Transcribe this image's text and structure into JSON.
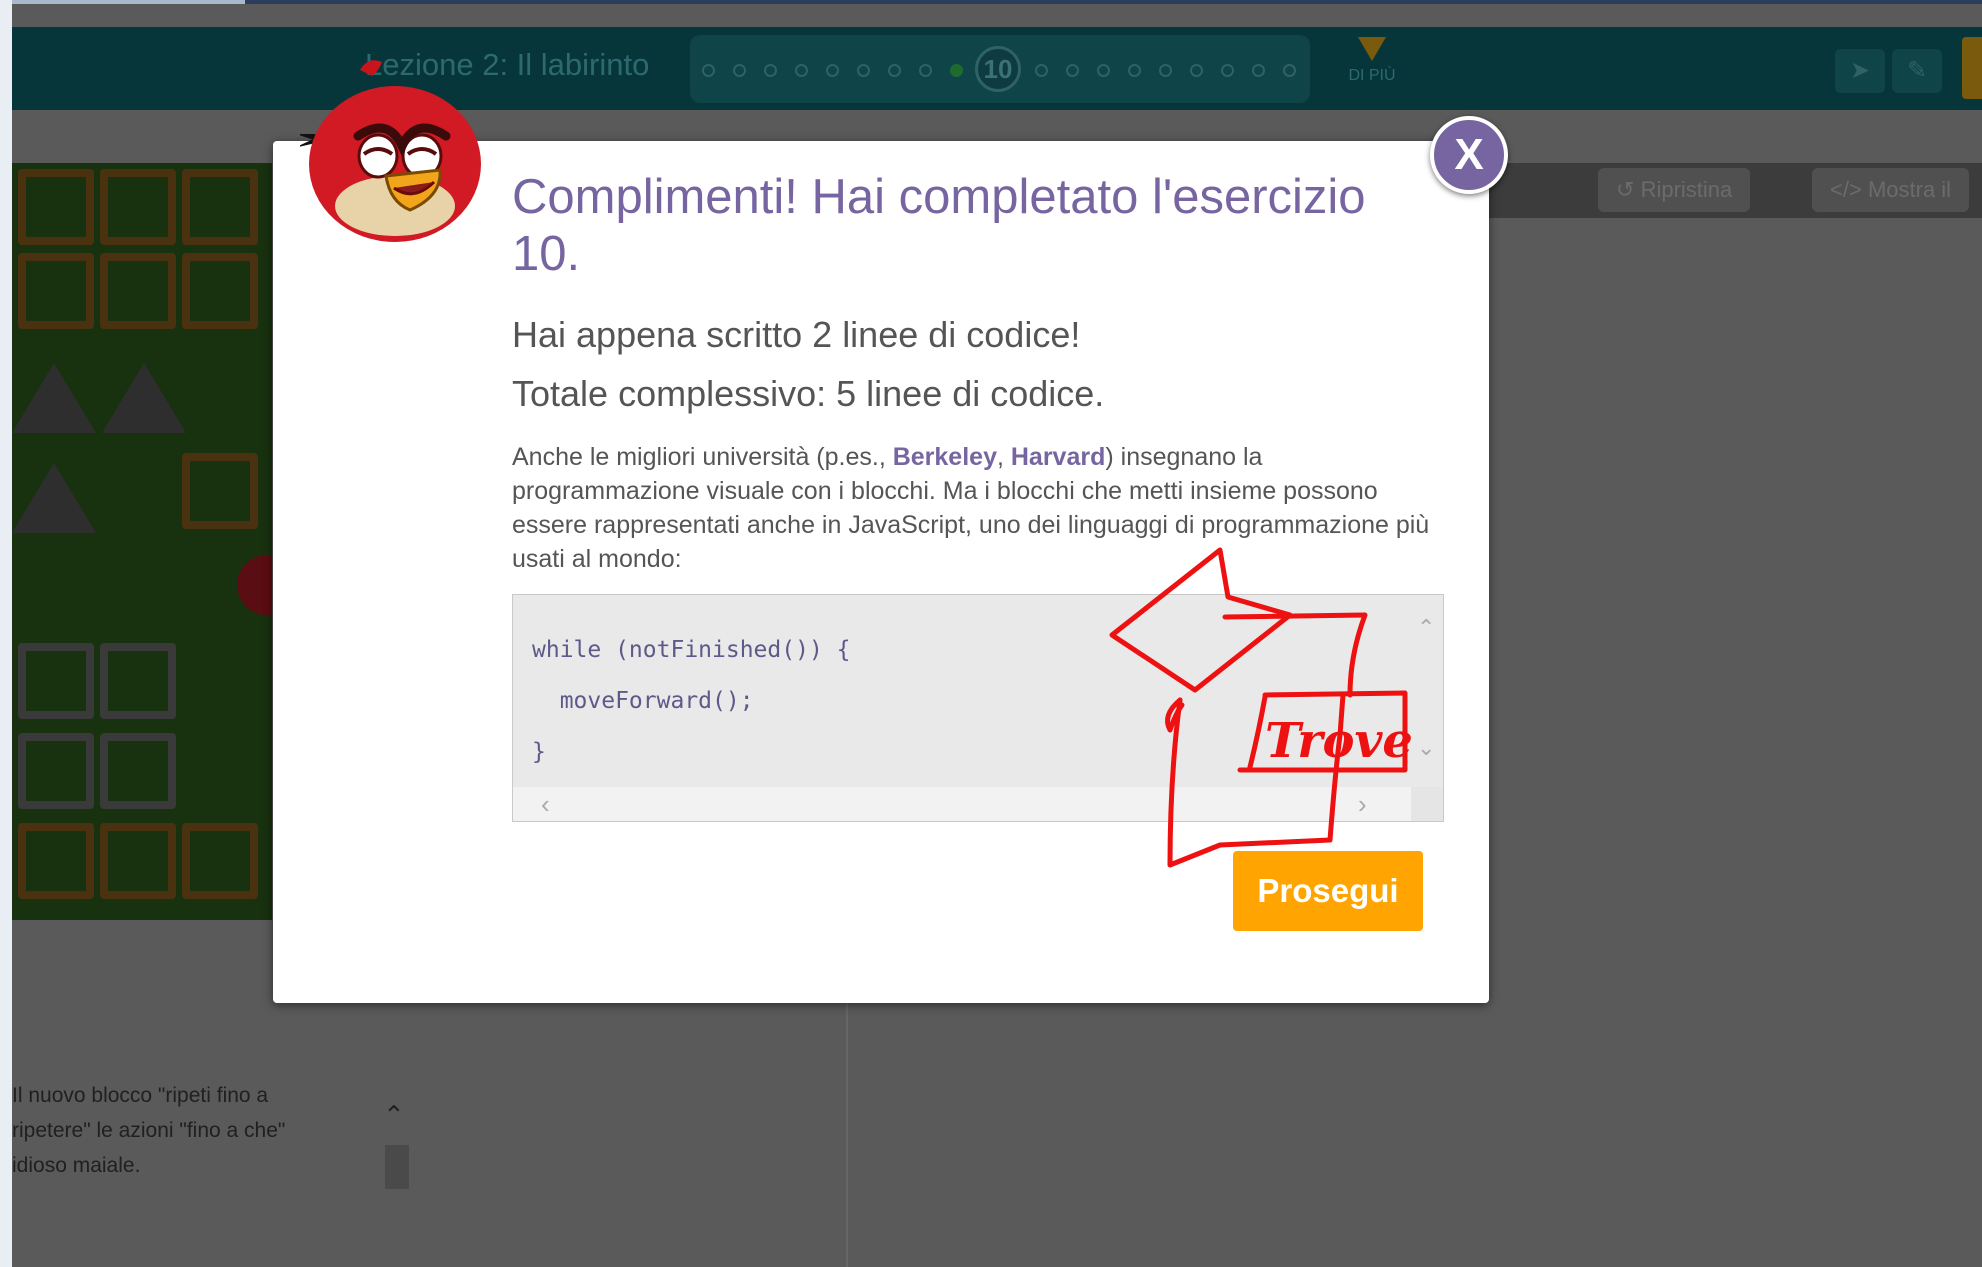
{
  "header": {
    "lesson_title": "Lezione 2: Il labirinto",
    "current_puzzle": "10",
    "more_label": "DI PIÙ"
  },
  "workspace": {
    "reset_label": "Ripristina",
    "show_code_label": "Mostra il"
  },
  "instructions": {
    "lines": [
      "Il nuovo blocco \"ripeti fino a",
      "ripetere\" le azioni \"fino a che\"",
      "idioso maiale."
    ]
  },
  "modal": {
    "title": "Complimenti! Hai completato l'esercizio 10.",
    "lines_written": "Hai appena scritto 2 linee di codice!",
    "lines_total": "Totale complessivo: 5 linee di codice.",
    "para_before": "Anche le migliori università (p.es., ",
    "berkeley": "Berkeley",
    "comma": ", ",
    "harvard": "Harvard",
    "para_after": ") insegnano la programmazione visuale con i blocchi. Ma i blocchi che metti insieme possono essere rappresentati anche in JavaScript, uno dei linguaggi di programmazione più usati al mondo:",
    "code_lines": [
      "while (notFinished()) {",
      "  moveForward();",
      "}"
    ],
    "continue_label": "Prosegui",
    "close_label": "X"
  },
  "annotation": {
    "handwritten_text": "Trove",
    "color": "#ee1111"
  },
  "colors": {
    "accent_purple": "#7665a0",
    "button_orange": "#ffa400",
    "header_teal": "#07363a"
  }
}
